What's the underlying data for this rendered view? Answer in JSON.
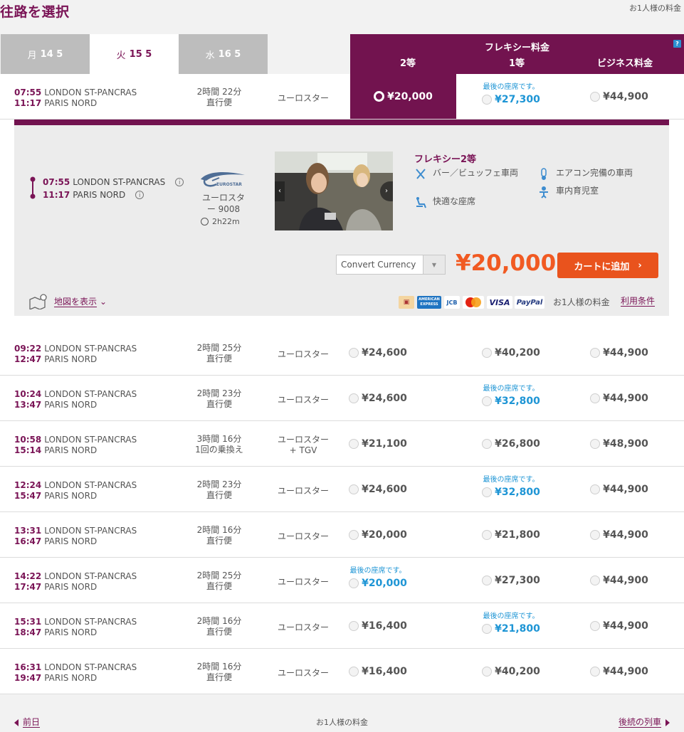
{
  "page": {
    "title": "往路を選択",
    "per_person_top": "お1人様の料金"
  },
  "dates": [
    {
      "dow": "月",
      "day": "14 5"
    },
    {
      "dow": "火",
      "day": "15 5"
    },
    {
      "dow": "水",
      "day": "16 5"
    }
  ],
  "fare_header": {
    "flexi": "フレキシー料金",
    "col_second": "2等",
    "col_first": "1等",
    "col_business": "ビジネス料金",
    "help": "?"
  },
  "last_seat_note": "最後の座席です。",
  "trains": [
    {
      "dep": "07:55",
      "arr": "11:17",
      "from": "LONDON ST-PANCRAS",
      "to": "PARIS NORD",
      "duration": "2時間 22分",
      "type": "直行便",
      "operator": [
        "ユーロスター"
      ],
      "second": "¥20,000",
      "first": "¥27,300",
      "business": "¥44,900",
      "last": "first"
    },
    {
      "dep": "09:22",
      "arr": "12:47",
      "from": "LONDON ST-PANCRAS",
      "to": "PARIS NORD",
      "duration": "2時間 25分",
      "type": "直行便",
      "operator": [
        "ユーロスター"
      ],
      "second": "¥24,600",
      "first": "¥40,200",
      "business": "¥44,900",
      "last": ""
    },
    {
      "dep": "10:24",
      "arr": "13:47",
      "from": "LONDON ST-PANCRAS",
      "to": "PARIS NORD",
      "duration": "2時間 23分",
      "type": "直行便",
      "operator": [
        "ユーロスター"
      ],
      "second": "¥24,600",
      "first": "¥32,800",
      "business": "¥44,900",
      "last": "first"
    },
    {
      "dep": "10:58",
      "arr": "15:14",
      "from": "LONDON ST-PANCRAS",
      "to": "PARIS NORD",
      "duration": "3時間 16分",
      "type": "1回の乗換え",
      "operator": [
        "ユーロスター",
        "+ TGV"
      ],
      "second": "¥21,100",
      "first": "¥26,800",
      "business": "¥48,900",
      "last": ""
    },
    {
      "dep": "12:24",
      "arr": "15:47",
      "from": "LONDON ST-PANCRAS",
      "to": "PARIS NORD",
      "duration": "2時間 23分",
      "type": "直行便",
      "operator": [
        "ユーロスター"
      ],
      "second": "¥24,600",
      "first": "¥32,800",
      "business": "¥44,900",
      "last": "first"
    },
    {
      "dep": "13:31",
      "arr": "16:47",
      "from": "LONDON ST-PANCRAS",
      "to": "PARIS NORD",
      "duration": "2時間 16分",
      "type": "直行便",
      "operator": [
        "ユーロスター"
      ],
      "second": "¥20,000",
      "first": "¥21,800",
      "business": "¥44,900",
      "last": ""
    },
    {
      "dep": "14:22",
      "arr": "17:47",
      "from": "LONDON ST-PANCRAS",
      "to": "PARIS NORD",
      "duration": "2時間 25分",
      "type": "直行便",
      "operator": [
        "ユーロスター"
      ],
      "second": "¥20,000",
      "first": "¥27,300",
      "business": "¥44,900",
      "last": "second"
    },
    {
      "dep": "15:31",
      "arr": "18:47",
      "from": "LONDON ST-PANCRAS",
      "to": "PARIS NORD",
      "duration": "2時間 16分",
      "type": "直行便",
      "operator": [
        "ユーロスター"
      ],
      "second": "¥16,400",
      "first": "¥21,800",
      "business": "¥44,900",
      "last": "first"
    },
    {
      "dep": "16:31",
      "arr": "19:47",
      "from": "LONDON ST-PANCRAS",
      "to": "PARIS NORD",
      "duration": "2時間 16分",
      "type": "直行便",
      "operator": [
        "ユーロスター"
      ],
      "second": "¥16,400",
      "first": "¥40,200",
      "business": "¥44,900",
      "last": ""
    }
  ],
  "detail": {
    "dep": "07:55",
    "arr": "11:17",
    "from": "LONDON ST-PANCRAS",
    "to": "PARIS NORD",
    "logo_text": "EUROSTAR",
    "operator_line1": "ユーロスタ",
    "operator_line2": "ー 9008",
    "duration": "2h22m",
    "info": "i",
    "amenity_title": "フレキシー2等",
    "amenities": {
      "bar": "バー／ビュッフェ車両",
      "aircon": "エアコン完備の車両",
      "nursery": "車内育児室",
      "seat": "快適な座席"
    },
    "currency_placeholder": "Convert Currency",
    "price": "¥20,000",
    "cart_label": "カートに追加",
    "map_label": "地図を表示",
    "per_person": "お1人様の料金",
    "terms": "利用条件",
    "payment": {
      "amex": "AMERICAN EXPRESS",
      "jcb": "JCB",
      "visa": "VISA",
      "paypal": "PayPal"
    }
  },
  "footer": {
    "prev": "前日",
    "per_person": "お1人様の料金",
    "next": "後続の列車"
  },
  "colors": {
    "brand": "#72134f",
    "accent": "#e9531d",
    "price": "#f15a22",
    "last_seat": "#1e95d5"
  }
}
